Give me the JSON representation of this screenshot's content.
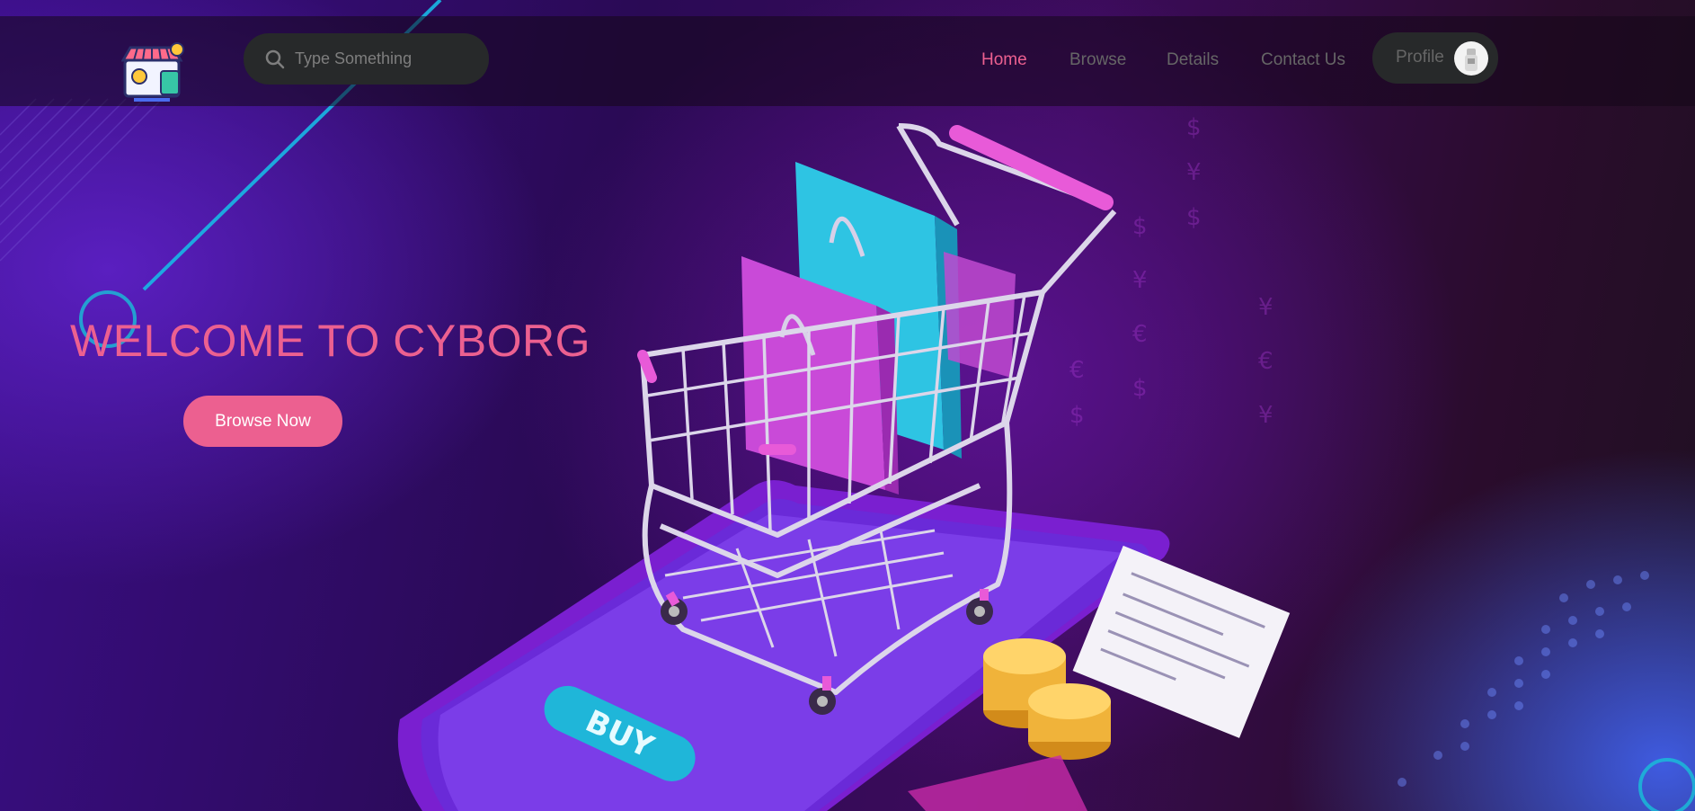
{
  "search": {
    "placeholder": "Type Something"
  },
  "nav": {
    "items": [
      {
        "label": "Home",
        "active": true
      },
      {
        "label": "Browse",
        "active": false
      },
      {
        "label": "Details",
        "active": false
      },
      {
        "label": "Contact Us",
        "active": false
      }
    ],
    "profile_label": "Profile"
  },
  "hero": {
    "title": "WELCOME TO CYBORG",
    "button_label": "Browse Now",
    "art_button_label": "BUY"
  },
  "colors": {
    "accent": "#ec6090",
    "nav_inactive": "#666666",
    "pill_bg": "#27292a"
  },
  "icons": [
    "shop-logo-icon",
    "search-icon",
    "avatar"
  ]
}
